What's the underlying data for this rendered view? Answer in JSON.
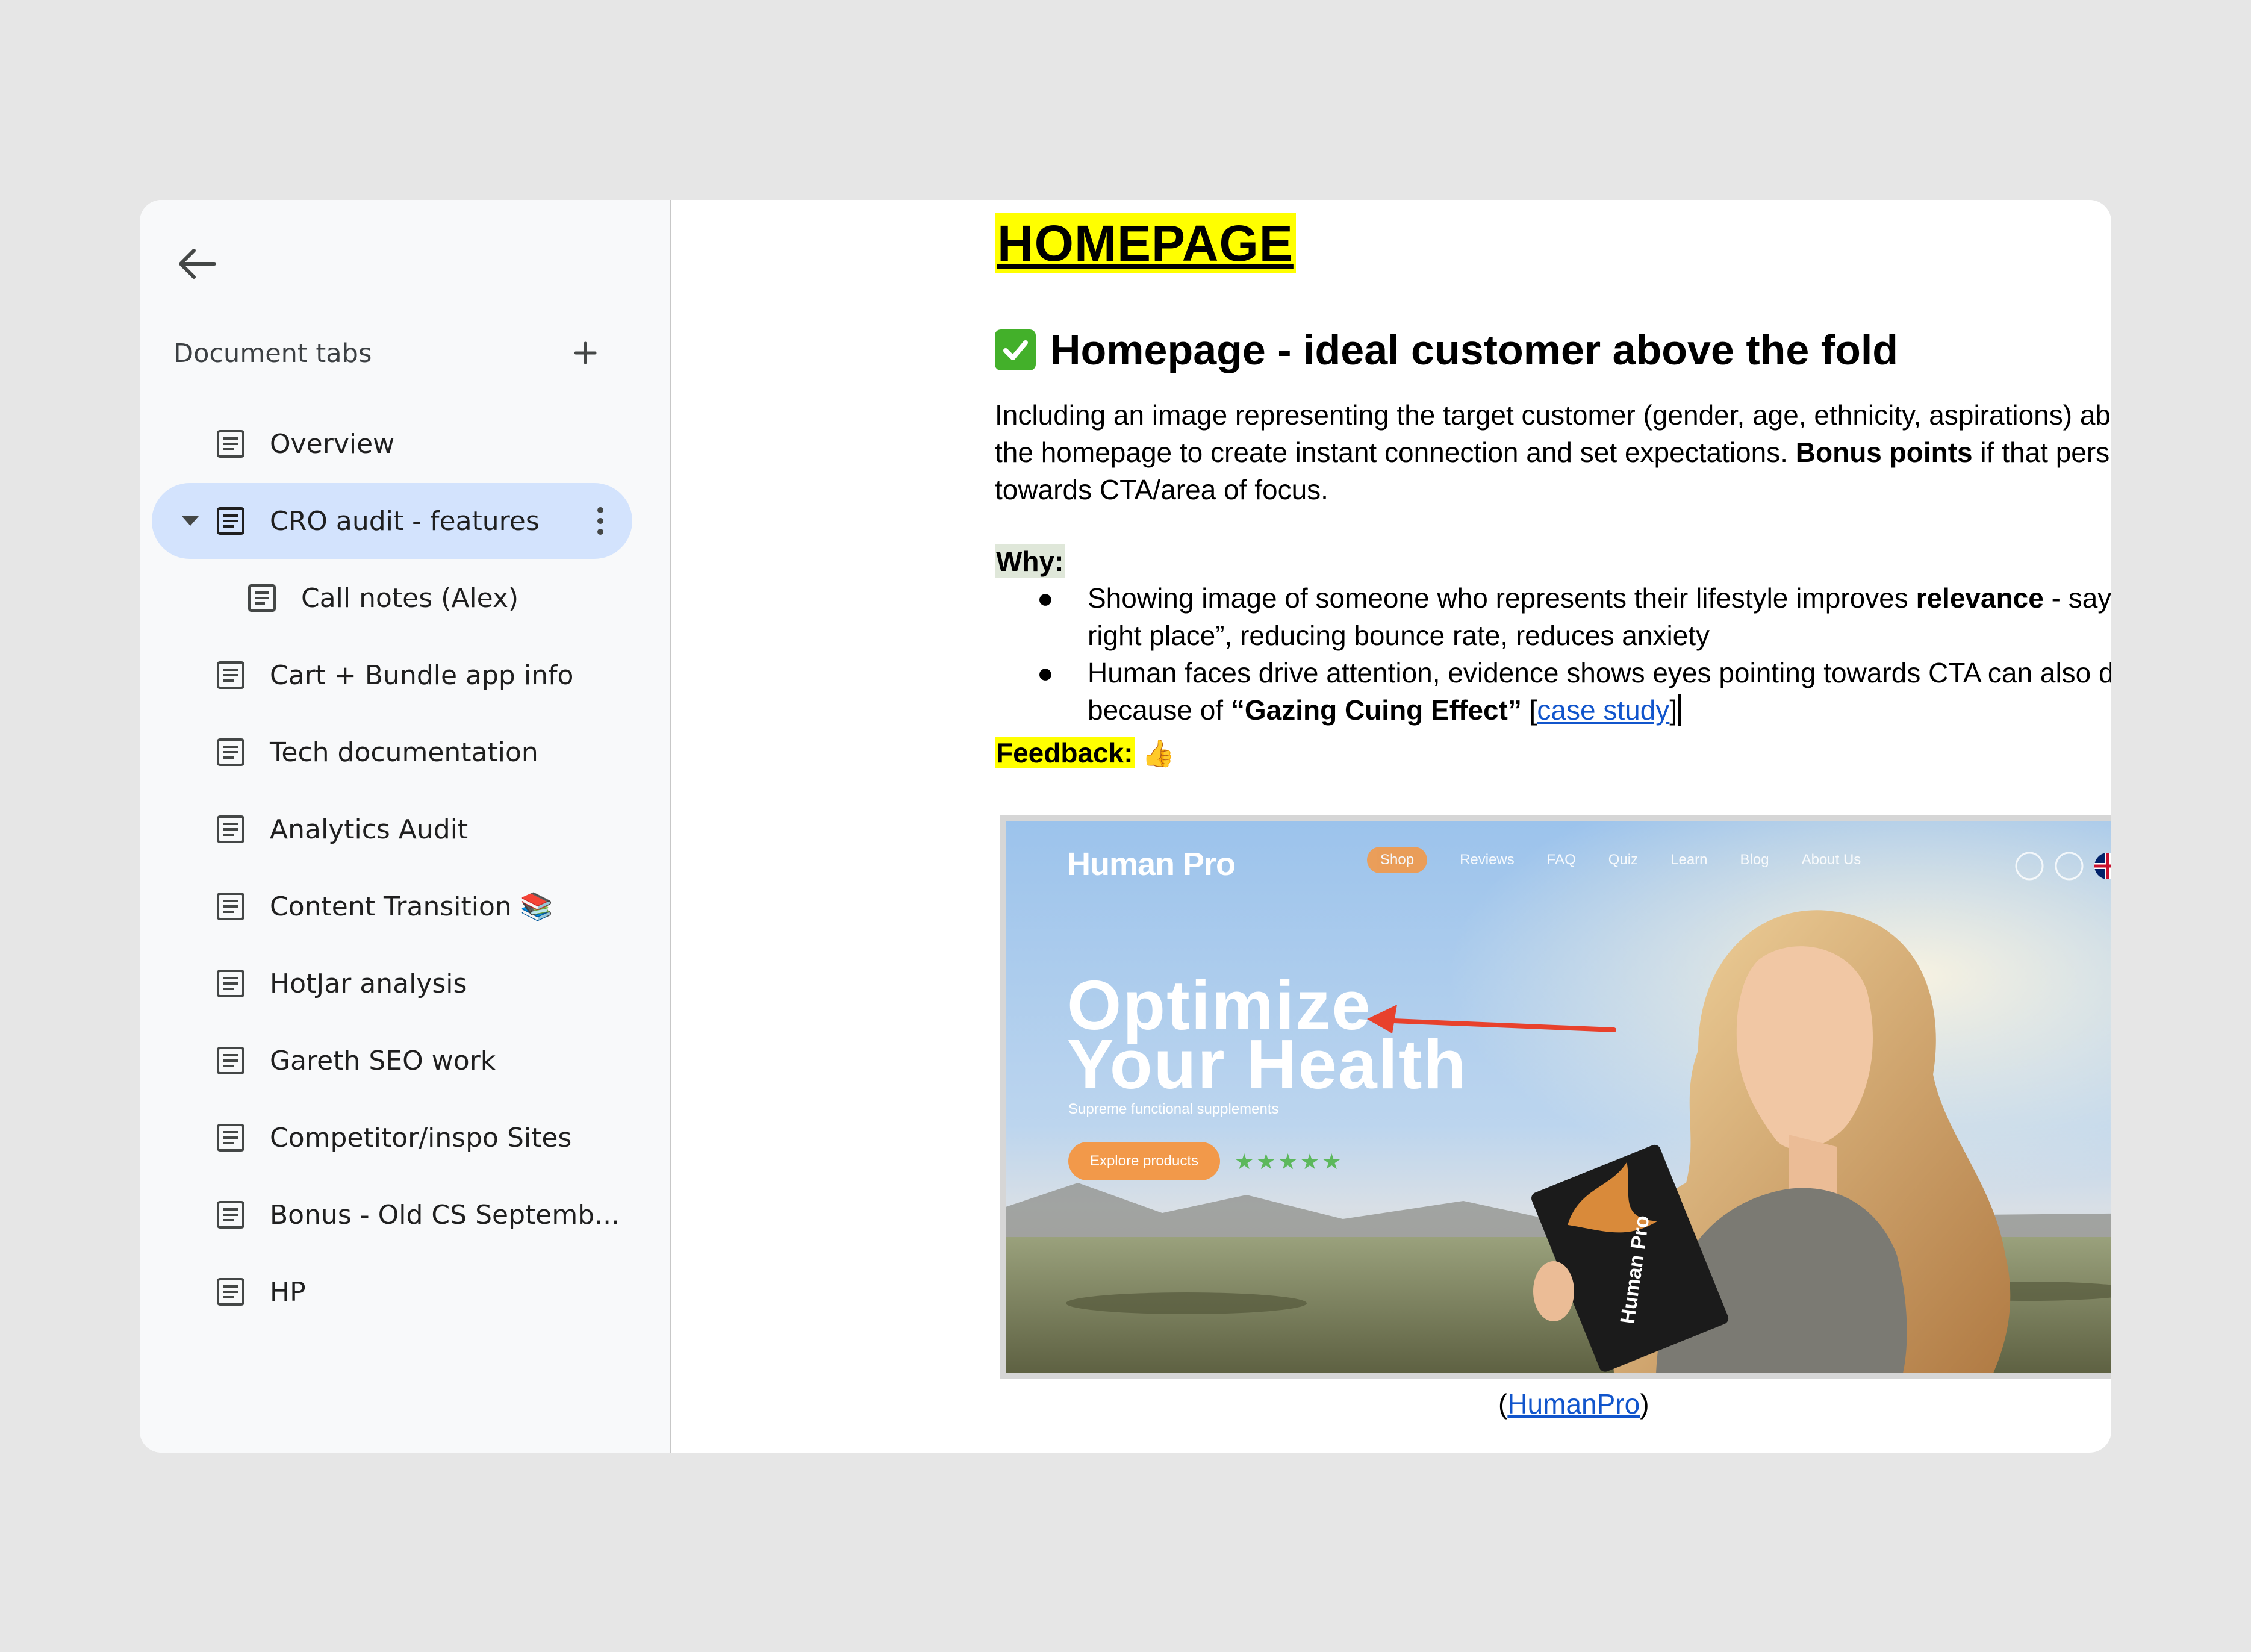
{
  "sidebar": {
    "heading": "Document tabs",
    "tabs": [
      {
        "label": "Overview"
      },
      {
        "label": "CRO audit - features"
      },
      {
        "label": "Call notes (Alex)"
      },
      {
        "label": "Cart + Bundle app info"
      },
      {
        "label": "Tech documentation"
      },
      {
        "label": "Analytics Audit"
      },
      {
        "label": "Content Transition 📚"
      },
      {
        "label": "HotJar analysis"
      },
      {
        "label": "Gareth SEO work"
      },
      {
        "label": "Competitor/inspo Sites"
      },
      {
        "label": "Bonus - Old CS Septemb..."
      },
      {
        "label": "HP"
      }
    ]
  },
  "doc": {
    "title": "HOMEPAGE",
    "heading": "Homepage - ideal customer above the fold",
    "para_1": "Including an image representing the target customer (gender, age, ethnicity, aspirations) above the fold on the homepage to create instant connection and set expectations. ",
    "para_bold": "Bonus points",
    "para_2": " if that person is looking towards CTA/area of focus.",
    "why_label": "Why:",
    "bullet1_a": "Showing image of someone who represents their lifestyle improves ",
    "bullet1_bold": "relevance",
    "bullet1_b": " - says “you’re in the right place”, reducing bounce rate, reduces anxiety",
    "bullet2_a": "Human faces drive attention, evidence shows eyes pointing towards CTA can also drive conversions because of ",
    "bullet2_bold": "“Gazing Cuing Effect”",
    "bullet2_b": " [",
    "bullet2_link": "case study",
    "bullet2_c": "]",
    "feedback_label": "Feedback:",
    "feedback_emoji": "👍",
    "caption_open": "(",
    "caption_link": "HumanPro",
    "caption_close": ")"
  },
  "screenshot": {
    "logo": "Human Pro",
    "nav": [
      "Shop",
      "Reviews",
      "FAQ",
      "Quiz",
      "Learn",
      "Blog",
      "About Us"
    ],
    "hero_line1": "Optimize",
    "hero_line2": "Your Health",
    "hero_sub": "Supreme functional supplements",
    "cta": "Explore products",
    "stars": "★★★★★",
    "pack_label": "Human Pro"
  },
  "colors": {
    "active_tab": "#d3e3fd",
    "highlight_yellow": "#ffff00",
    "link": "#1155cc",
    "accent_orange": "#f2994a",
    "arrow_red": "#e8412c"
  }
}
